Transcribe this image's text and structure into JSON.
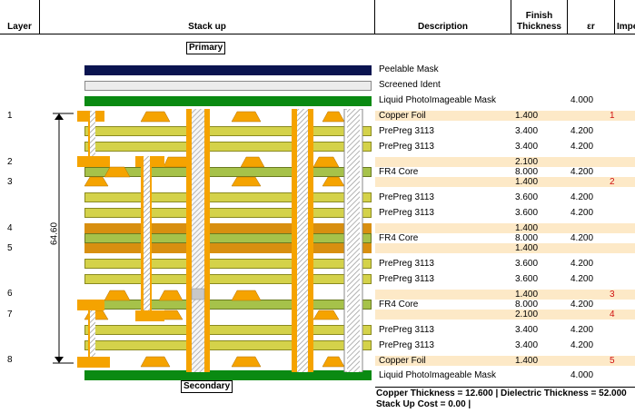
{
  "header": {
    "layer": "Layer",
    "stackup": "Stack up",
    "description": "Description",
    "finish_line1": "Finish",
    "finish_line2": "Thickness",
    "er": "εr",
    "imp": "Impe"
  },
  "labels": {
    "primary": "Primary",
    "secondary": "Secondary",
    "total_thickness": "64.60"
  },
  "layer_numbers": [
    "1",
    "2",
    "3",
    "4",
    "5",
    "6",
    "7",
    "8"
  ],
  "rows": [
    {
      "desc": "Peelable Mask",
      "thk": "",
      "er": "",
      "imp": ""
    },
    {
      "desc": "Screened Ident",
      "thk": "",
      "er": "",
      "imp": ""
    },
    {
      "desc": "Liquid PhotoImageable Mask",
      "thk": "",
      "er": "4.000",
      "imp": ""
    },
    {
      "desc": "Copper Foil",
      "thk": "1.400",
      "er": "",
      "imp": "1"
    },
    {
      "desc": "PrePreg 3113",
      "thk": "3.400",
      "er": "4.200",
      "imp": ""
    },
    {
      "desc": "PrePreg 3113",
      "thk": "3.400",
      "er": "4.200",
      "imp": ""
    },
    {
      "desc": "",
      "thk": "2.100",
      "er": "",
      "imp": ""
    },
    {
      "desc": "FR4 Core",
      "thk": "8.000",
      "er": "4.200",
      "imp": ""
    },
    {
      "desc": "",
      "thk": "1.400",
      "er": "",
      "imp": "2"
    },
    {
      "desc": "PrePreg 3113",
      "thk": "3.600",
      "er": "4.200",
      "imp": ""
    },
    {
      "desc": "PrePreg 3113",
      "thk": "3.600",
      "er": "4.200",
      "imp": ""
    },
    {
      "desc": "",
      "thk": "1.400",
      "er": "",
      "imp": ""
    },
    {
      "desc": "FR4 Core",
      "thk": "8.000",
      "er": "4.200",
      "imp": ""
    },
    {
      "desc": "",
      "thk": "1.400",
      "er": "",
      "imp": ""
    },
    {
      "desc": "PrePreg 3113",
      "thk": "3.600",
      "er": "4.200",
      "imp": ""
    },
    {
      "desc": "PrePreg 3113",
      "thk": "3.600",
      "er": "4.200",
      "imp": ""
    },
    {
      "desc": "",
      "thk": "1.400",
      "er": "",
      "imp": "3"
    },
    {
      "desc": "FR4 Core",
      "thk": "8.000",
      "er": "4.200",
      "imp": ""
    },
    {
      "desc": "",
      "thk": "2.100",
      "er": "",
      "imp": "4"
    },
    {
      "desc": "PrePreg 3113",
      "thk": "3.400",
      "er": "4.200",
      "imp": ""
    },
    {
      "desc": "PrePreg 3113",
      "thk": "3.400",
      "er": "4.200",
      "imp": ""
    },
    {
      "desc": "Copper Foil",
      "thk": "1.400",
      "er": "",
      "imp": "5"
    },
    {
      "desc": "Liquid PhotoImageable Mask",
      "thk": "",
      "er": "4.000",
      "imp": ""
    }
  ],
  "summary": {
    "line1": "Copper Thickness = 12.600  | Dielectric Thickness = 52.000",
    "line2": "Stack Up Cost = 0.00  |"
  },
  "colors": {
    "peelable_mask": "#0a1450",
    "screened_ident": "#ececec",
    "solder_mask": "#0a8a12",
    "copper": "#f5a300",
    "prepreg": "#d4d24a",
    "core": "#a6c24a",
    "copper_plane": "#d88f10",
    "row_highlight": "#fde9c7"
  }
}
